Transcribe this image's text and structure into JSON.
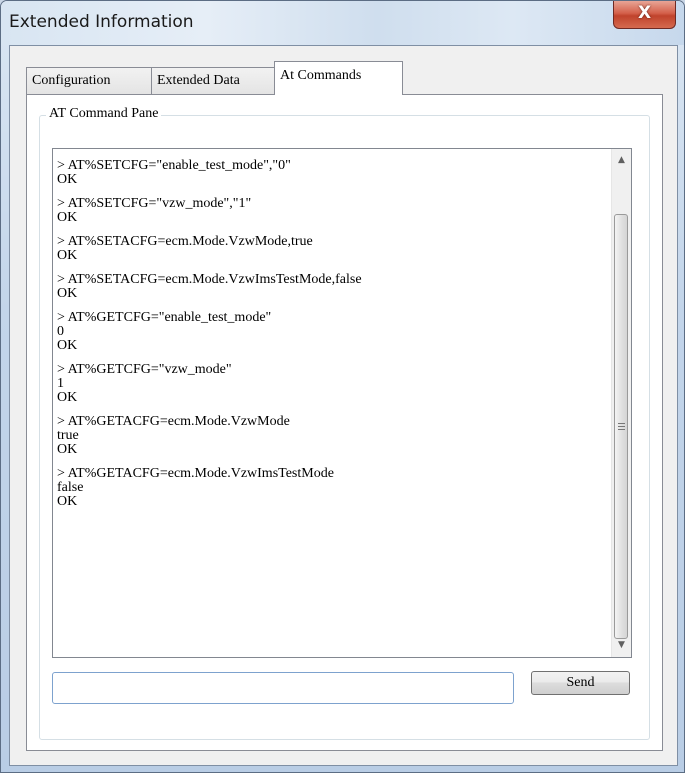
{
  "window": {
    "title": "Extended Information",
    "close_glyph": "X"
  },
  "tabs": [
    {
      "label": "Configuration",
      "active": false
    },
    {
      "label": "Extended Data",
      "active": false
    },
    {
      "label": "At Commands",
      "active": true
    }
  ],
  "pane": {
    "legend": "AT Command Pane",
    "output": [
      {
        "lines": [
          "> AT%SETCFG=\"enable_test_mode\",\"0\"",
          "OK"
        ]
      },
      {
        "lines": [
          "> AT%SETCFG=\"vzw_mode\",\"1\"",
          "OK"
        ]
      },
      {
        "lines": [
          "> AT%SETACFG=ecm.Mode.VzwMode,true",
          "OK"
        ]
      },
      {
        "lines": [
          "> AT%SETACFG=ecm.Mode.VzwImsTestMode,false",
          "OK"
        ]
      },
      {
        "lines": [
          "> AT%GETCFG=\"enable_test_mode\"",
          "0",
          "OK"
        ]
      },
      {
        "lines": [
          "> AT%GETCFG=\"vzw_mode\"",
          "1",
          "OK"
        ]
      },
      {
        "lines": [
          "> AT%GETACFG=ecm.Mode.VzwMode",
          "true",
          "OK"
        ]
      },
      {
        "lines": [
          "> AT%GETACFG=ecm.Mode.VzwImsTestMode",
          "false",
          "OK"
        ]
      }
    ],
    "scrollbar": {
      "up_icon": "arrow-up-icon",
      "down_icon": "arrow-down-icon"
    },
    "command_input": {
      "value": "",
      "placeholder": ""
    },
    "send_label": "Send"
  }
}
